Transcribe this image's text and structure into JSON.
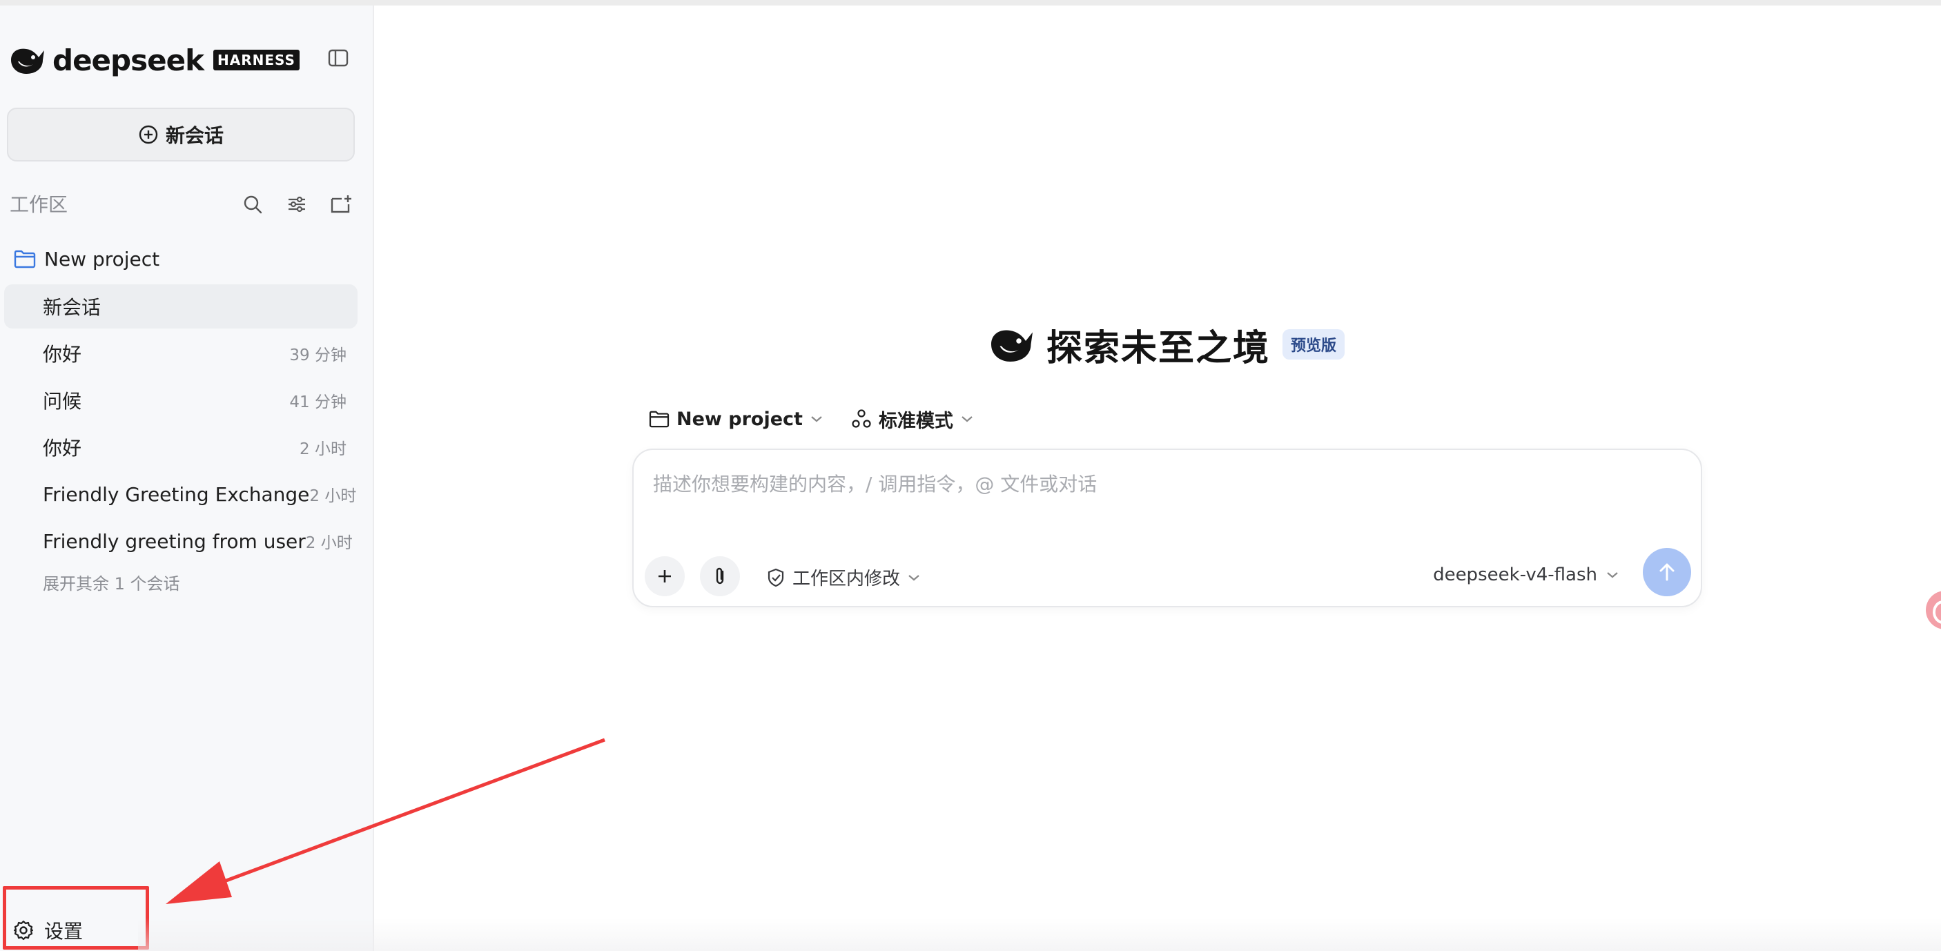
{
  "app": {
    "brand_name": "deepseek",
    "brand_badge": "HARNESS"
  },
  "sidebar": {
    "new_chat_label": "新会话",
    "workspace_label": "工作区",
    "project_name": "New project",
    "conversations": [
      {
        "title": "新会话",
        "time": "",
        "active": true
      },
      {
        "title": "你好",
        "time": "39 分钟",
        "active": false
      },
      {
        "title": "问候",
        "time": "41 分钟",
        "active": false
      },
      {
        "title": "你好",
        "time": "2 小时",
        "active": false
      },
      {
        "title": "Friendly Greeting Exchange",
        "time": "2 小时",
        "active": false
      },
      {
        "title": "Friendly greeting from user",
        "time": "2 小时",
        "active": false
      }
    ],
    "expand_more_label": "展开其余 1 个会话",
    "settings_label": "设置"
  },
  "main": {
    "hero_title": "探索未至之境",
    "hero_badge": "预览版",
    "project_selector": "New project",
    "mode_selector": "标准模式",
    "composer": {
      "placeholder": "描述你想要构建的内容，/ 调用指令，@ 文件或对话",
      "value": "",
      "permission_label": "工作区内修改",
      "model_label": "deepseek-v4-flash"
    }
  },
  "colors": {
    "sidebar_bg": "#f7f8fa",
    "accent_send": "#a9c3f5",
    "badge_bg": "#e4ecfb",
    "annotation_red": "#ef3b3b"
  },
  "icons": {
    "brand": "whale-icon",
    "sidebar_toggle": "sidebar-toggle-icon",
    "new_chat": "plus-circle-icon",
    "search": "search-icon",
    "filter": "sliders-icon",
    "new_folder": "add-folder-icon",
    "project": "folder-icon",
    "settings": "gear-icon",
    "attach": "paperclip-icon",
    "add": "plus-icon",
    "permission": "shield-icon",
    "send": "arrow-up-icon"
  }
}
